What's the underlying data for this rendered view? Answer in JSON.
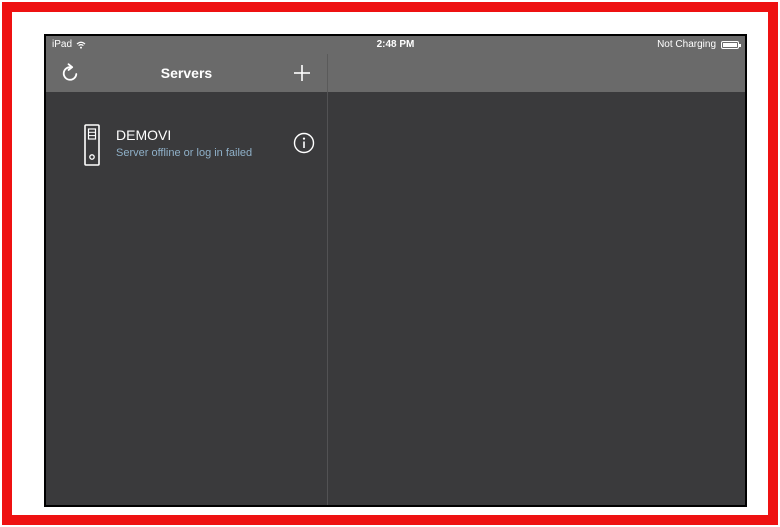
{
  "status_bar": {
    "device": "iPad",
    "time": "2:48 PM",
    "charging": "Not Charging"
  },
  "nav": {
    "title": "Servers",
    "refresh_icon": "refresh-icon",
    "add_icon": "plus-icon"
  },
  "servers": [
    {
      "name": "DEMOVI",
      "status": "Server offline or log in failed",
      "icon": "server-icon",
      "info_icon": "info-icon"
    }
  ],
  "colors": {
    "frame": "#ee1111",
    "bar": "#6a6a6a",
    "background": "#3a3a3c",
    "status_text": "#8fb0c8"
  }
}
